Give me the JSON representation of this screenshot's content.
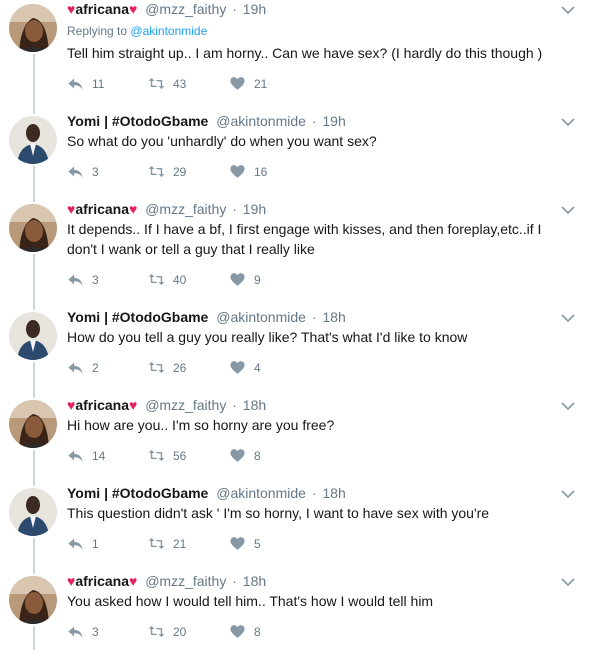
{
  "replying_prefix": "Replying to",
  "replying_handle": "@akintonmide",
  "separator": "·",
  "tweets": [
    {
      "name": "africana",
      "hearts": true,
      "handle": "@mzz_faithy",
      "time": "19h",
      "text": "Tell him straight up.. I am horny.. Can we have sex? (I hardly do this though )",
      "replies": "11",
      "retweets": "43",
      "likes": "21",
      "avatar": "female"
    },
    {
      "name": "Yomi | #OtodoGbame",
      "hearts": false,
      "handle": "@akintonmide",
      "time": "19h",
      "text": "So what do you 'unhardly' do when you want sex?",
      "replies": "3",
      "retweets": "29",
      "likes": "16",
      "avatar": "male"
    },
    {
      "name": "africana",
      "hearts": true,
      "handle": "@mzz_faithy",
      "time": "19h",
      "text": "It depends.. If I have a bf, I first engage with kisses, and then foreplay,etc..if I don't I wank or tell a guy that I really like",
      "replies": "3",
      "retweets": "40",
      "likes": "9",
      "avatar": "female"
    },
    {
      "name": "Yomi | #OtodoGbame",
      "hearts": false,
      "handle": "@akintonmide",
      "time": "18h",
      "text": "How do you tell a guy you really like? That's what I'd like to know",
      "replies": "2",
      "retweets": "26",
      "likes": "4",
      "avatar": "male"
    },
    {
      "name": "africana",
      "hearts": true,
      "handle": "@mzz_faithy",
      "time": "18h",
      "text": "Hi how are you.. I'm so horny are you free?",
      "replies": "14",
      "retweets": "56",
      "likes": "8",
      "avatar": "female"
    },
    {
      "name": "Yomi | #OtodoGbame",
      "hearts": false,
      "handle": "@akintonmide",
      "time": "18h",
      "text": "This question didn't ask ' I'm so horny, I want to have sex with you're",
      "replies": "1",
      "retweets": "21",
      "likes": "5",
      "avatar": "male"
    },
    {
      "name": "africana",
      "hearts": true,
      "handle": "@mzz_faithy",
      "time": "18h",
      "text": "You asked how I would tell him.. That's how I would tell him",
      "replies": "3",
      "retweets": "20",
      "likes": "8",
      "avatar": "female"
    }
  ]
}
